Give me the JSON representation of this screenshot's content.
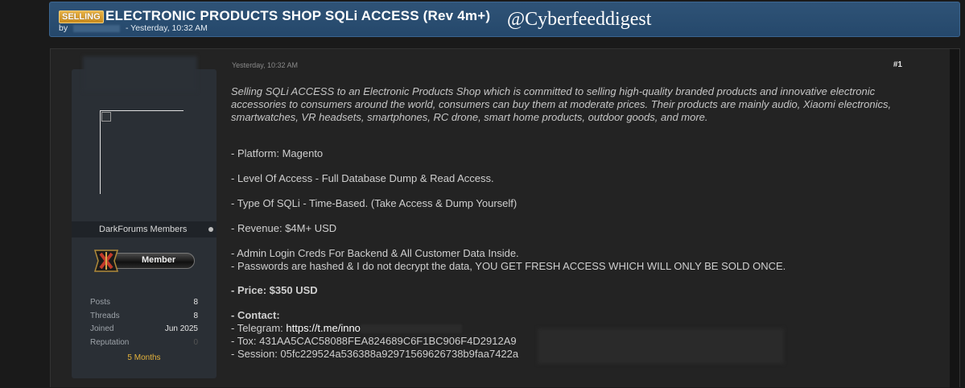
{
  "thread": {
    "prefix": "SELLING",
    "title": "ELECTRONIC PRODUCTS SHOP SQLi ACCESS (Rev 4m+)",
    "by_label": "by",
    "posted": "- Yesterday, 10:32 AM"
  },
  "watermark": "@Cyberfeeddigest",
  "post": {
    "date": "Yesterday, 10:32 AM",
    "number": "#1",
    "intro": "Selling SQLi ACCESS to an Electronic Products Shop which is committed to selling high-quality branded products and innovative electronic accessories to consumers around the world, consumers can buy them at moderate prices. Their products are mainly audio, Xiaomi electronics, smartwatches, VR headsets, smartphones, RC drone, smart home products, outdoor goods, and more.",
    "platform": "- Platform: Magento",
    "access_level": "- Level Of Access - Full Database Dump & Read Access.",
    "sqli_type": "- Type Of SQLi - Time-Based. (Take Access & Dump Yourself)",
    "revenue": "- Revenue: $4M+ USD",
    "creds": "- Admin Login Creds For Backend & All Customer Data Inside.",
    "passwords": "- Passwords are hashed & I do not decrypt the data, YOU GET FRESH ACCESS WHICH WILL ONLY BE SOLD ONCE.",
    "price": "- Price: $350 USD",
    "contact_heading": "- Contact:",
    "telegram_label": "- Telegram: ",
    "telegram_link": "https://t.me/inno",
    "tox_label": "- Tox:  ",
    "tox_value": "431AA5CAC58088FEA824689C6F1BC906F4D2912A9",
    "session_label": "- Session:  ",
    "session_value": "05fc229524a536388a92971569626738b9faa7422a"
  },
  "user": {
    "usergroup": "DarkForums Members",
    "rank": "Member",
    "stats": [
      {
        "label": "Posts",
        "value": "8"
      },
      {
        "label": "Threads",
        "value": "8"
      },
      {
        "label": "Joined",
        "value": "Jun 2025"
      },
      {
        "label": "Reputation",
        "value": "0"
      }
    ],
    "tenure": "5 Months"
  },
  "colors": {
    "header_bar": "#2f5377",
    "prefix_badge": "#e8b347",
    "tenure": "#e3b23c"
  }
}
